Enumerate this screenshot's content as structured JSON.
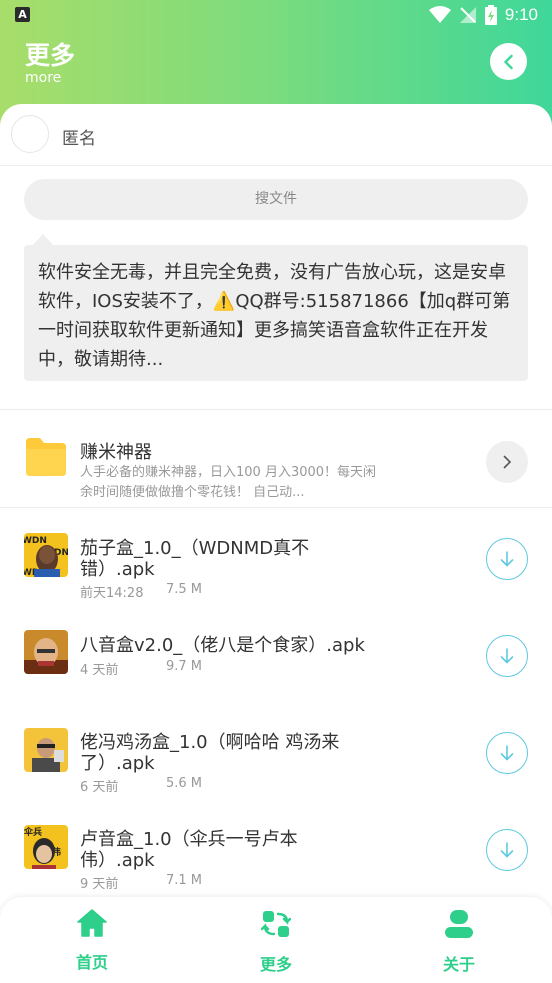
{
  "status_bar": {
    "app_badge": "A",
    "time": "9:10"
  },
  "header": {
    "title": "更多",
    "subtitle": "more",
    "back_icon": "chevron-left-icon"
  },
  "user": {
    "name": "匿名"
  },
  "search": {
    "placeholder": "搜文件"
  },
  "notice": {
    "text": "软件安全无毒，并且完全免费，没有广告放心玩，这是安卓软件，IOS安装不了，⚠️QQ群号:515871866【加q群可第一时间获取软件更新通知】更多搞笑语音盒软件正在开发中，敬请期待..."
  },
  "folder": {
    "title": "赚米神器",
    "description": "人手必备的赚米神器，日入100 月入3000！每天闲余时间随便做做撸个零花钱！ 自己动..."
  },
  "files": [
    {
      "name": "茄子盒_1.0_（WDNMD真不错）.apk",
      "date": "前天14:28",
      "size": "7.5 M"
    },
    {
      "name": "八音盒v2.0_（佬八是个食家）.apk",
      "date": "4 天前",
      "size": "9.7 M"
    },
    {
      "name": "佬冯鸡汤盒_1.0（啊哈哈 鸡汤来了）.apk",
      "date": "6 天前",
      "size": "5.6 M"
    },
    {
      "name": "卢音盒_1.0（伞兵一号卢本伟）.apk",
      "date": "9 天前",
      "size": "7.1 M"
    }
  ],
  "nav": {
    "home": "首页",
    "more": "更多",
    "about": "关于"
  },
  "colors": {
    "accent": "#2ecf8a",
    "download_ring": "#5fc9df",
    "header_start": "#a8dd6a",
    "header_end": "#3fd79a"
  }
}
